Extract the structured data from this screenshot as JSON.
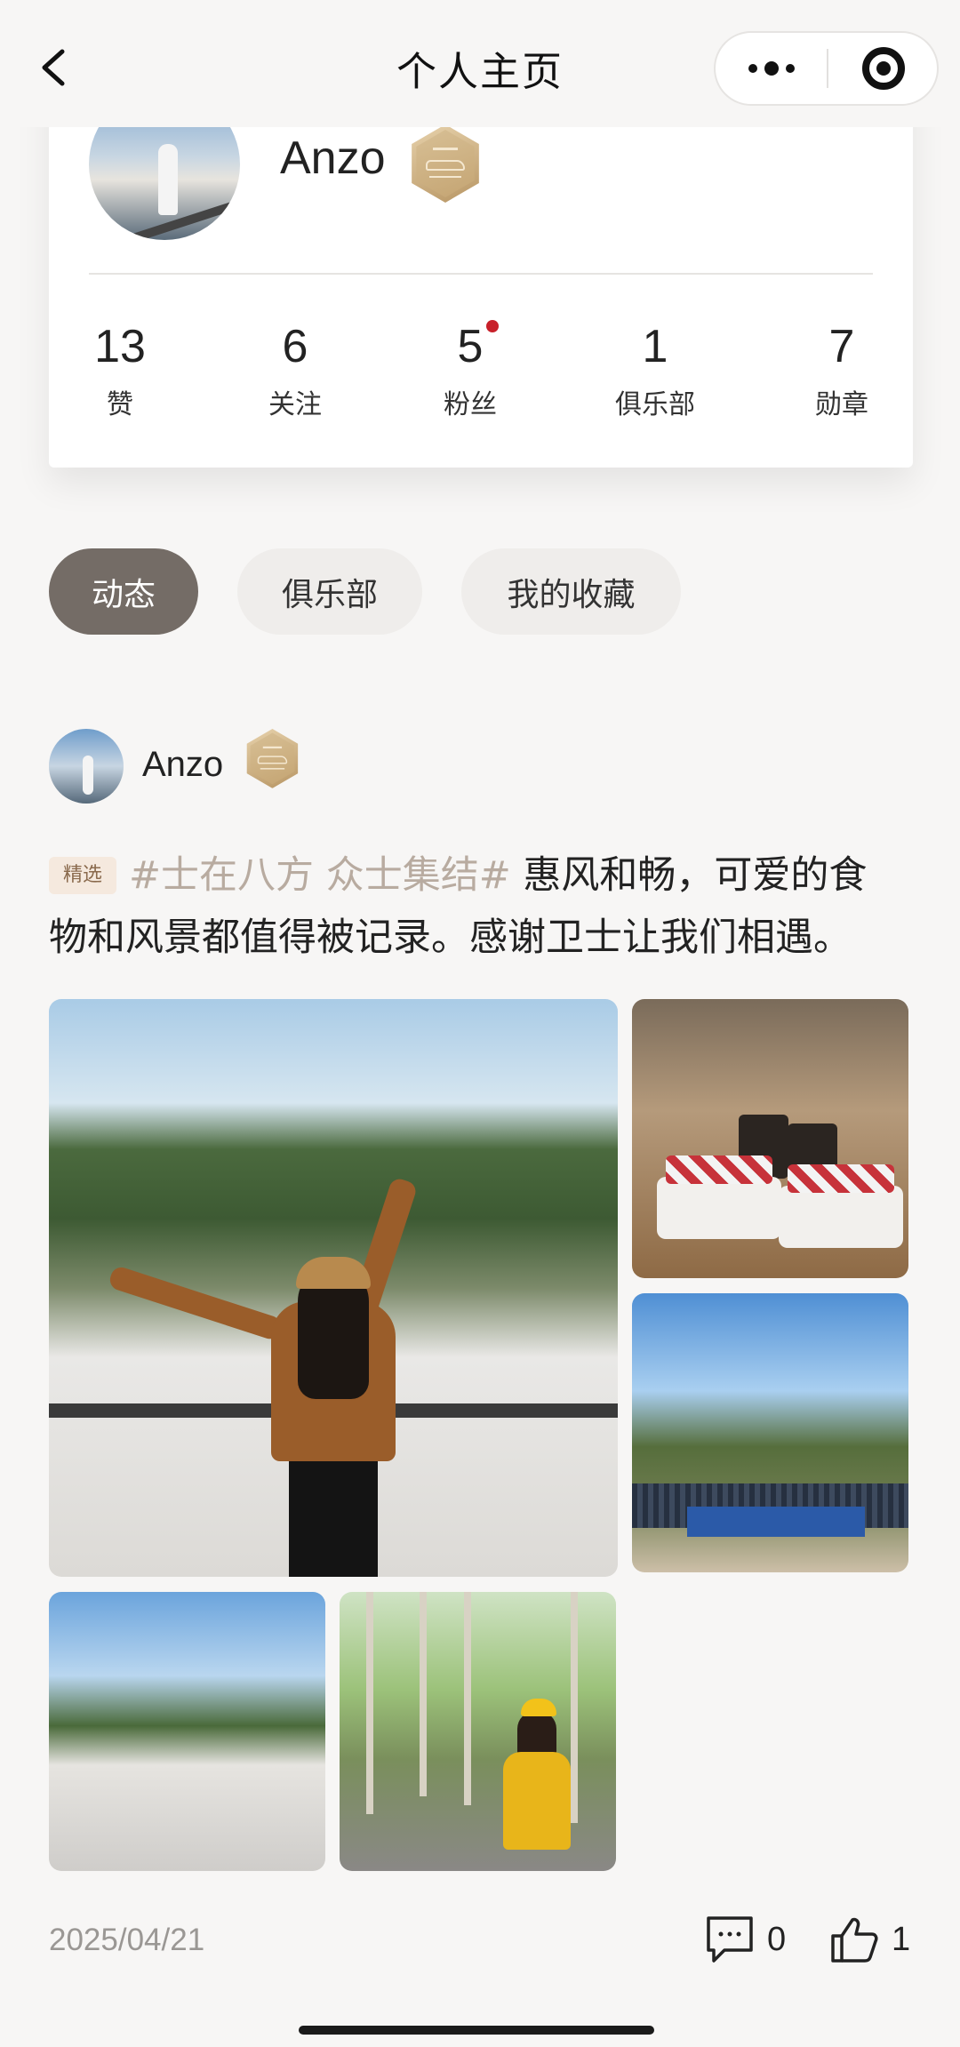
{
  "nav": {
    "title": "个人主页"
  },
  "profile": {
    "name": "Anzo",
    "stats": [
      {
        "value": "13",
        "label": "赞"
      },
      {
        "value": "6",
        "label": "关注"
      },
      {
        "value": "5",
        "label": "粉丝"
      },
      {
        "value": "1",
        "label": "俱乐部"
      },
      {
        "value": "7",
        "label": "勋章"
      }
    ]
  },
  "tabs": [
    {
      "label": "动态",
      "active": true
    },
    {
      "label": "俱乐部",
      "active": false
    },
    {
      "label": "我的收藏",
      "active": false
    }
  ],
  "post": {
    "author": "Anzo",
    "featured_tag": "精选",
    "hashtag": "#士在八方 众士集结#",
    "body": " 惠风和畅，可爱的食物和风景都值得被记录。感谢卫士让我们相遇。",
    "date": "2025/04/21",
    "comment_count": "0",
    "like_count": "1"
  },
  "colors": {
    "background": "#f7f6f5",
    "active_tab": "#746c66",
    "notification_dot": "#c8202a",
    "hashtag": "#b8aba0"
  },
  "icons": [
    "back-arrow-icon",
    "more-dots-icon",
    "close-target-icon",
    "badge-icon",
    "comment-icon",
    "thumbs-up-icon"
  ]
}
